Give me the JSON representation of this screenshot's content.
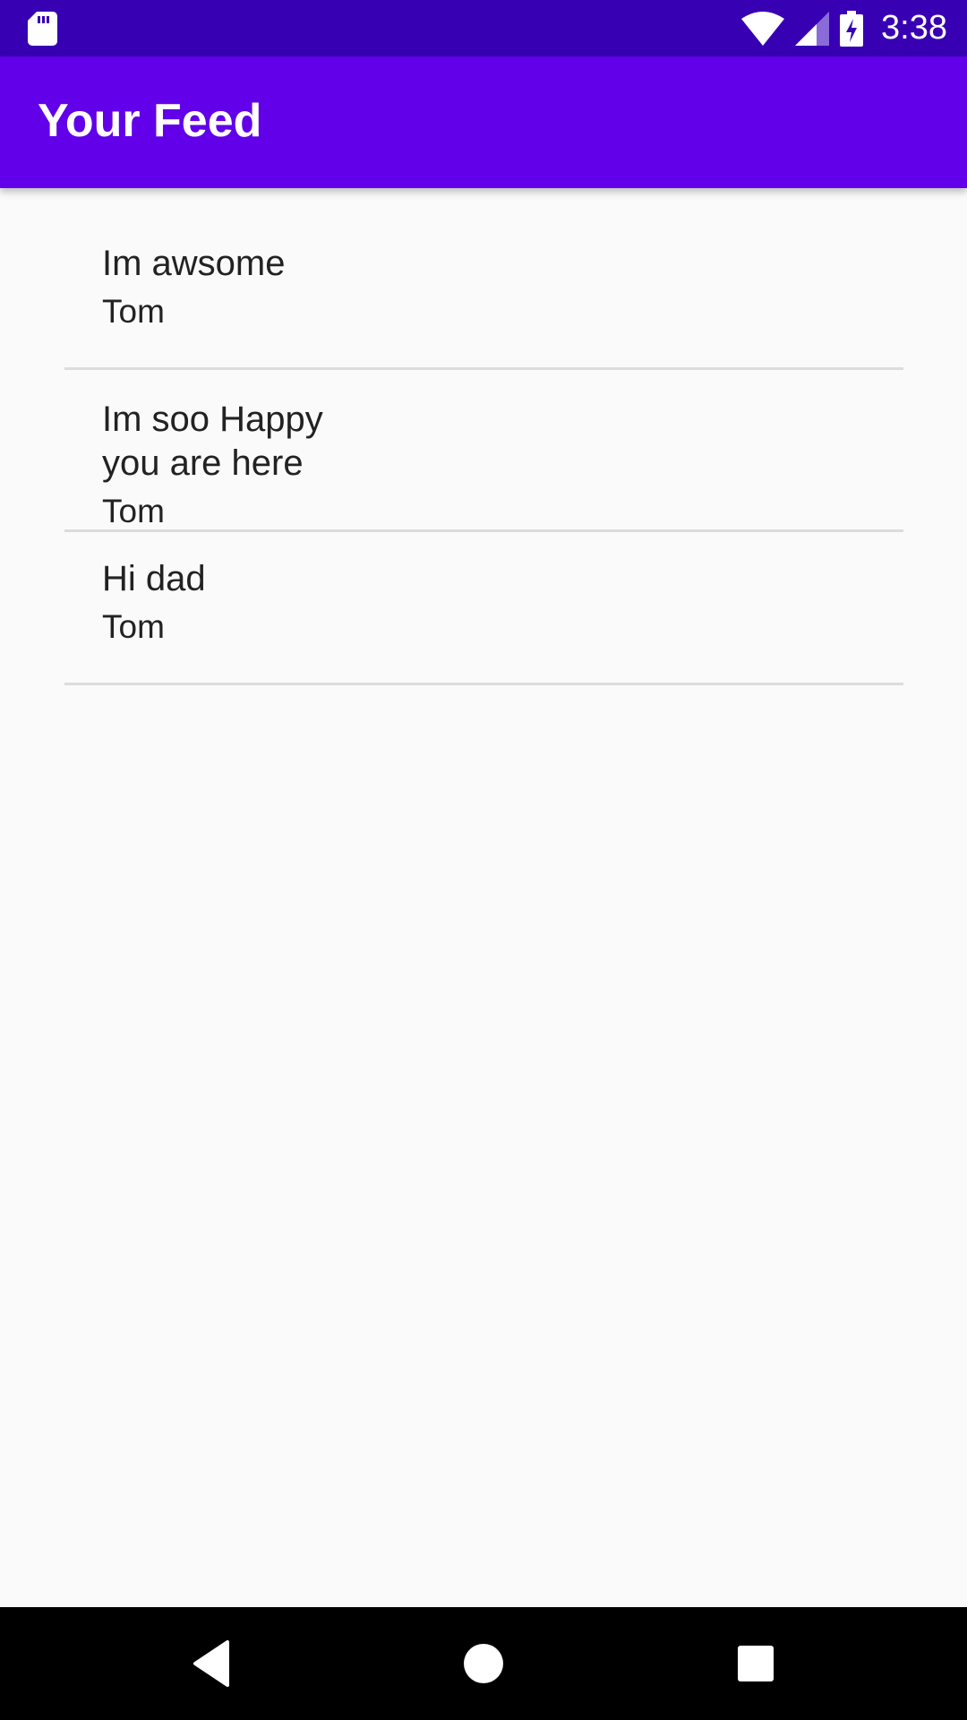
{
  "status_bar": {
    "time": "3:38",
    "icons": [
      "sd-card-icon",
      "wifi-icon",
      "signal-icon",
      "battery-charging-icon"
    ],
    "background": "#3700b3"
  },
  "app_bar": {
    "title": "Your Feed",
    "background": "#6200ea"
  },
  "feed": {
    "items": [
      {
        "message": "Im awsome",
        "author": "Tom"
      },
      {
        "message": "Im soo Happy\nyou are here",
        "author": "Tom"
      },
      {
        "message": "Hi dad",
        "author": "Tom"
      }
    ]
  },
  "nav_bar": {
    "buttons": [
      "back-icon",
      "home-icon",
      "recents-icon"
    ]
  }
}
